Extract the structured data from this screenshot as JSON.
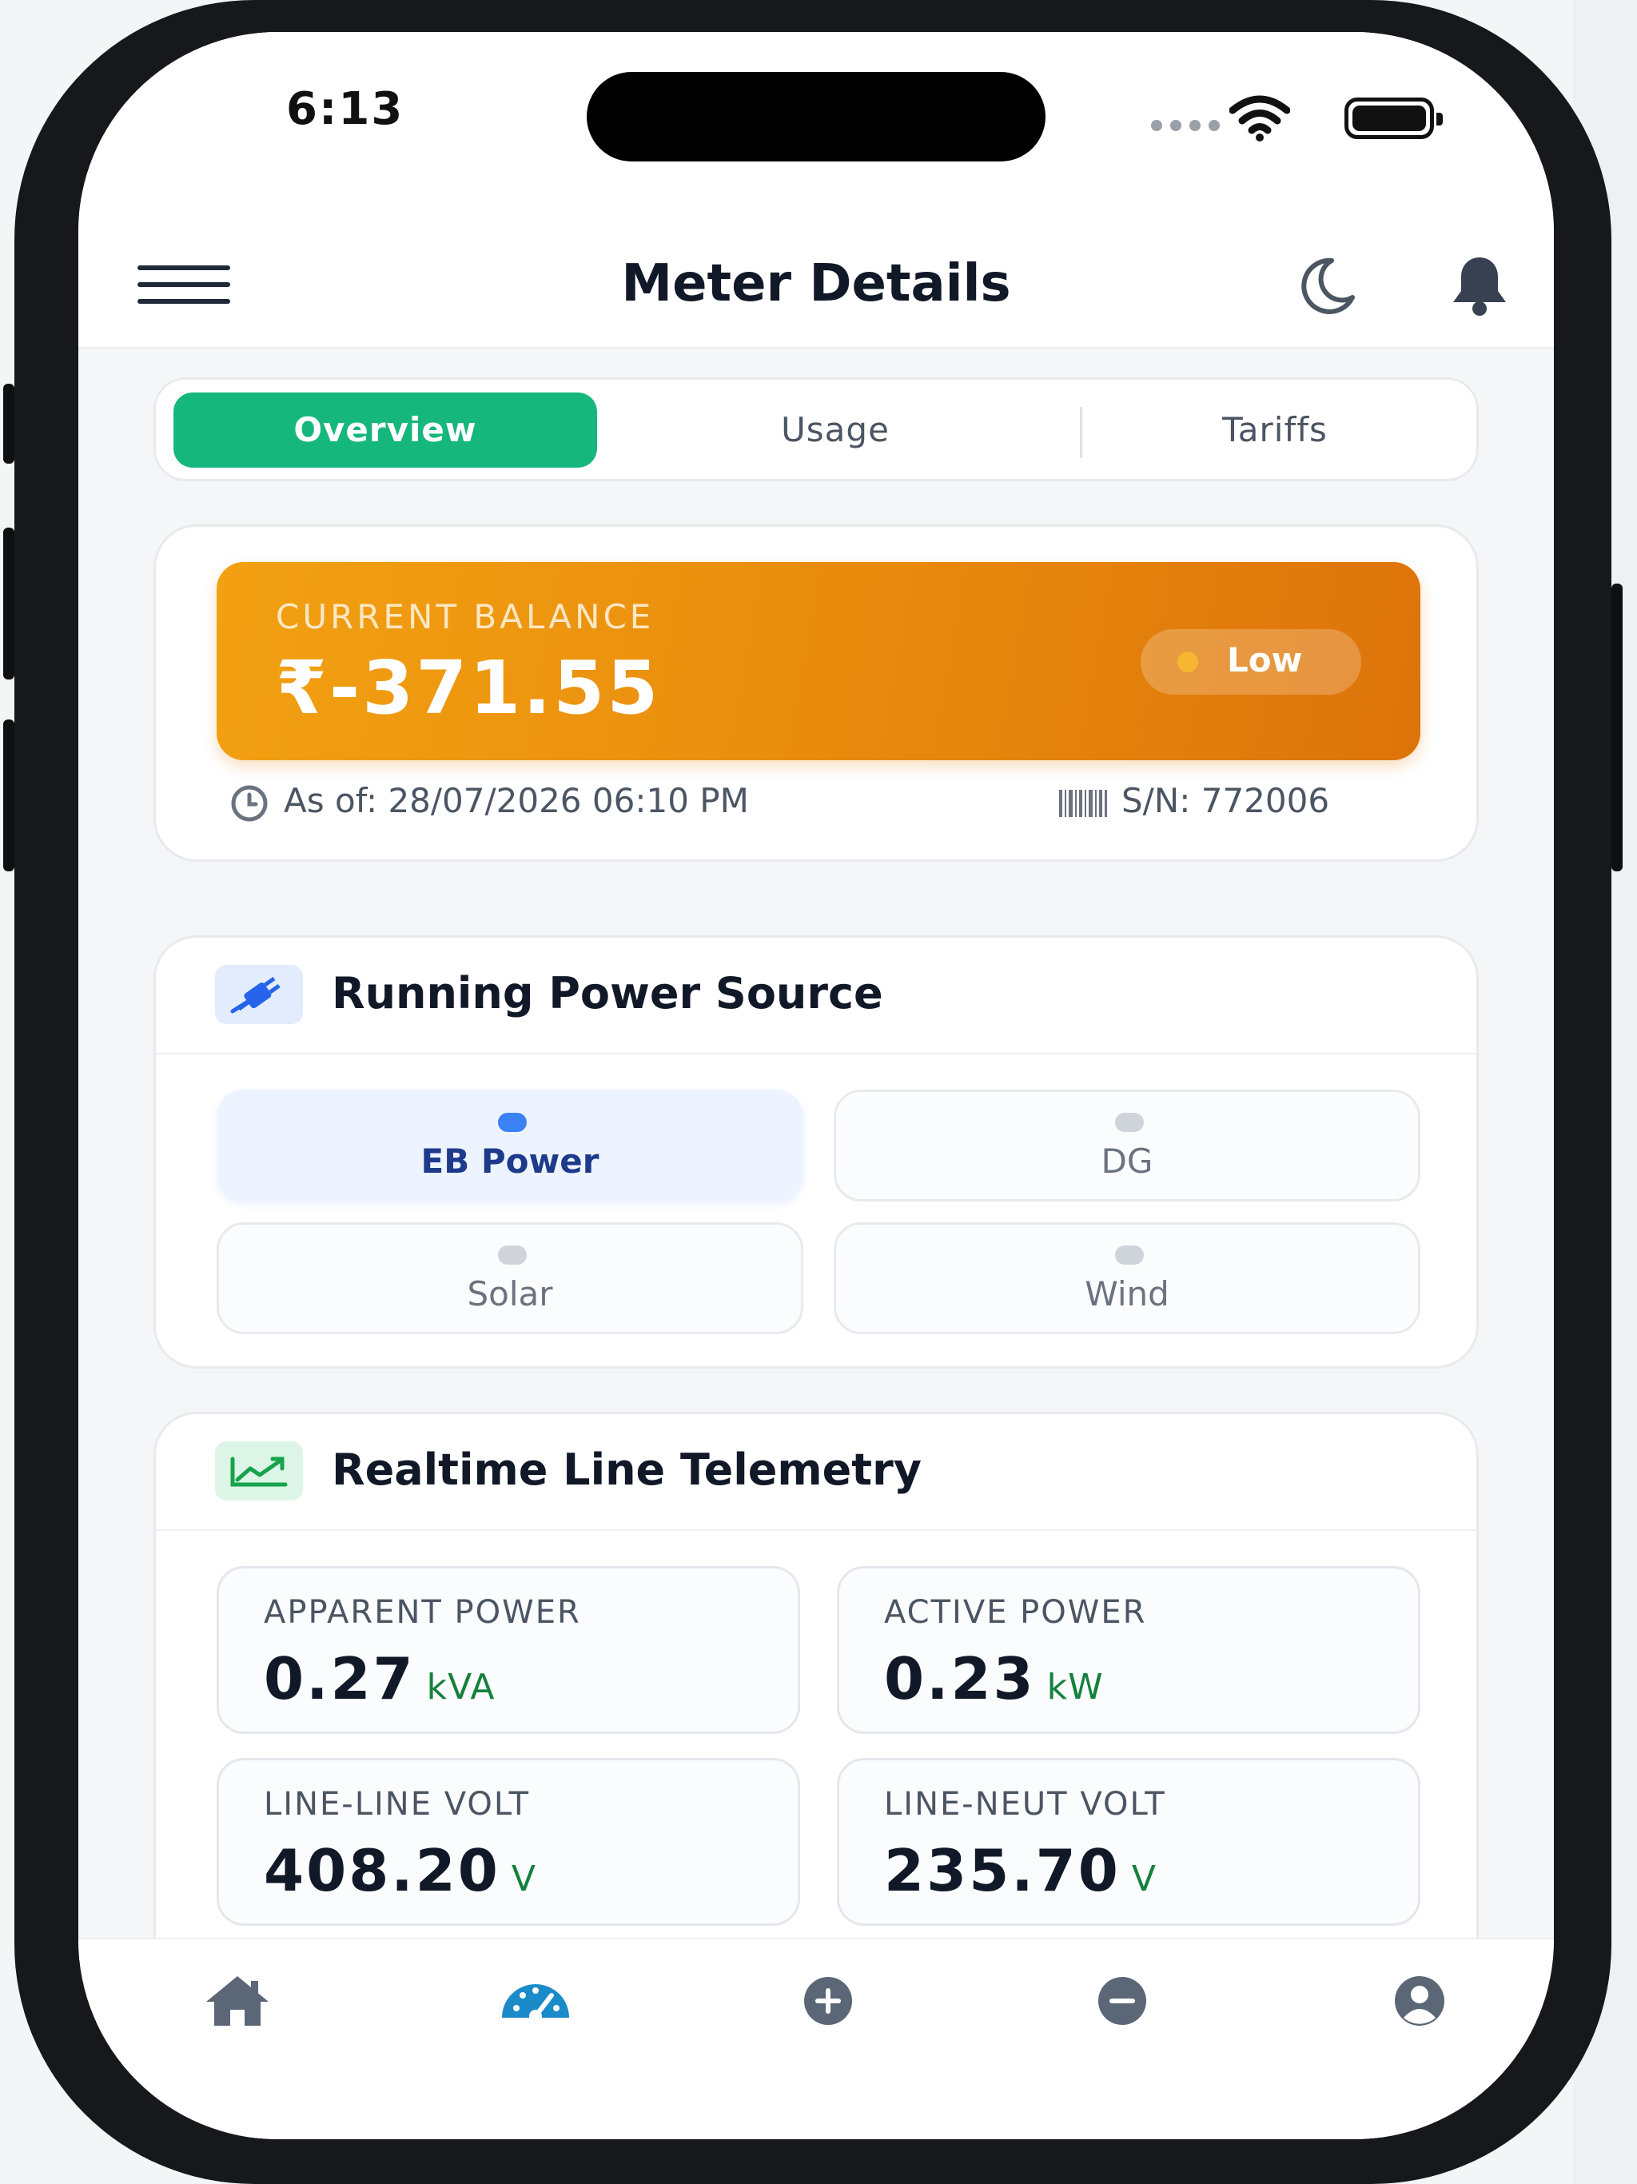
{
  "status_bar": {
    "time": "6:13"
  },
  "header": {
    "title": "Meter Details"
  },
  "tabs": [
    {
      "label": "Overview",
      "active": true
    },
    {
      "label": "Usage",
      "active": false
    },
    {
      "label": "Tariffs",
      "active": false
    }
  ],
  "balance": {
    "label": "CURRENT BALANCE",
    "amount": "₹-371.55",
    "status": "Low",
    "as_of": "As of: 28/07/2026 06:10 PM",
    "serial": "S/N: 772006"
  },
  "power_source": {
    "title": "Running Power Source",
    "sources": [
      {
        "label": "EB Power",
        "active": true
      },
      {
        "label": "DG",
        "active": false
      },
      {
        "label": "Solar",
        "active": false
      },
      {
        "label": "Wind",
        "active": false
      }
    ]
  },
  "telemetry": {
    "title": "Realtime Line Telemetry",
    "metrics": [
      {
        "label": "APPARENT POWER",
        "value": "0.27",
        "unit": "kVA"
      },
      {
        "label": "ACTIVE POWER",
        "value": "0.23",
        "unit": "kW"
      },
      {
        "label": "LINE-LINE VOLT",
        "value": "408.20",
        "unit": "V"
      },
      {
        "label": "LINE-NEUT VOLT",
        "value": "235.70",
        "unit": "V"
      }
    ]
  },
  "bottom_nav": {
    "items": [
      {
        "icon": "home-icon",
        "active": false
      },
      {
        "icon": "dashboard-gauge-icon",
        "active": true
      },
      {
        "icon": "plus-circle-icon",
        "active": false
      },
      {
        "icon": "minus-circle-icon",
        "active": false
      },
      {
        "icon": "user-icon",
        "active": false
      }
    ]
  },
  "colors": {
    "accent_green": "#16b77d",
    "balance_orange": "#e88a0d",
    "active_blue": "#3b82f6",
    "nav_active": "#1a8bc8"
  }
}
